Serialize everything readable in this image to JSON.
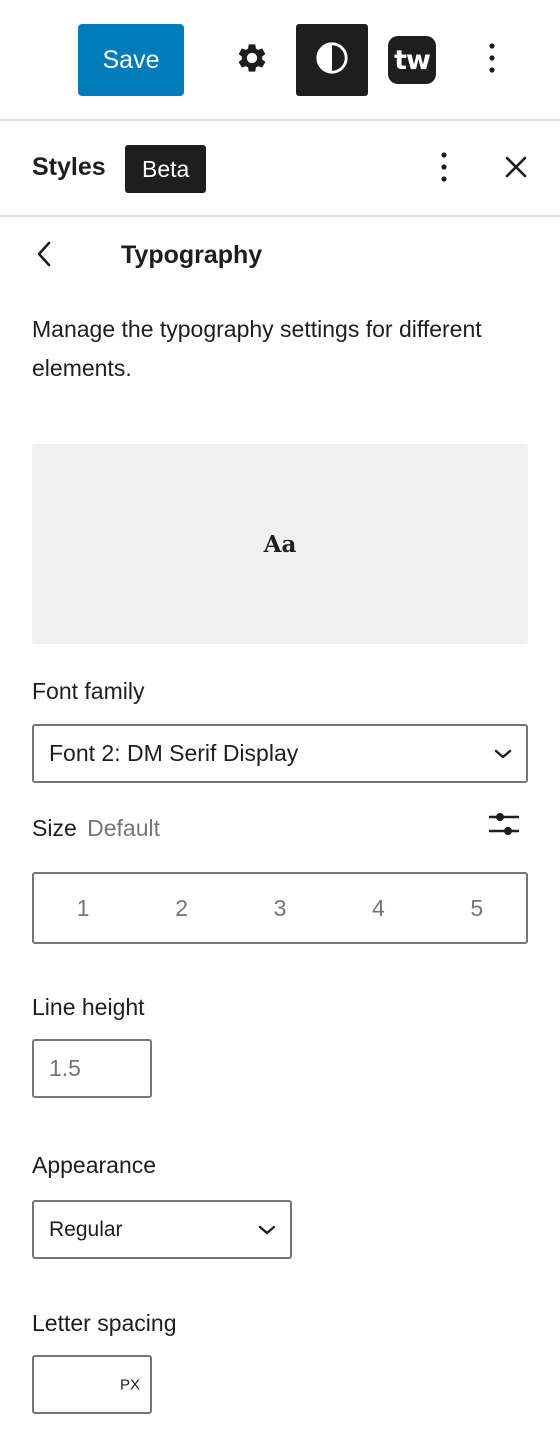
{
  "toolbar": {
    "save_label": "Save",
    "logo_text": "tw",
    "accent_color": "#007cba",
    "icons": [
      "gear-icon",
      "contrast-icon",
      "more-vertical-icon"
    ]
  },
  "styles_panel": {
    "title": "Styles",
    "badge": "Beta",
    "icons": [
      "more-vertical-icon",
      "close-icon"
    ]
  },
  "typography": {
    "title": "Typography",
    "description": "Manage the typography settings for different elements.",
    "preview_text": "Aa",
    "font_family": {
      "label": "Font family",
      "value": "Font 2: DM Serif Display"
    },
    "size": {
      "label": "Size",
      "current": "Default",
      "options": [
        "1",
        "2",
        "3",
        "4",
        "5"
      ]
    },
    "line_height": {
      "label": "Line height",
      "placeholder": "1.5"
    },
    "appearance": {
      "label": "Appearance",
      "value": "Regular"
    },
    "letter_spacing": {
      "label": "Letter spacing",
      "value": "",
      "unit": "PX"
    }
  }
}
